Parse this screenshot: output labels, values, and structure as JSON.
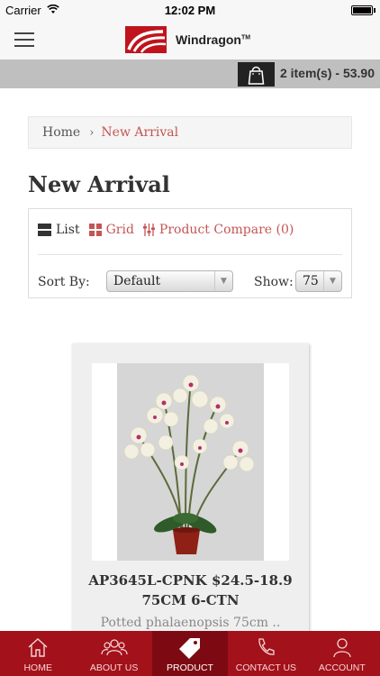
{
  "status_bar": {
    "carrier": "Carrier",
    "time": "12:02 PM"
  },
  "header": {
    "brand": "Windragon",
    "trademark": "TM"
  },
  "cart": {
    "summary": "2 item(s) - 53.90"
  },
  "breadcrumb": {
    "home": "Home",
    "separator": "›",
    "current": "New Arrival"
  },
  "page": {
    "title": "New Arrival"
  },
  "toolbar": {
    "list_label": "List",
    "grid_label": "Grid",
    "compare_label": "Product Compare (0)",
    "sort_label": "Sort By:",
    "sort_value": "Default",
    "show_label": "Show:",
    "show_value": "75"
  },
  "product": {
    "title_line1": "AP3645L-CPNK $24.5-18.9",
    "title_line2": "75CM 6-CTN",
    "description": "Potted phalaenopsis 75cm .."
  },
  "tabs": [
    {
      "label": "HOME",
      "icon": "home-icon"
    },
    {
      "label": "ABOUT US",
      "icon": "people-icon"
    },
    {
      "label": "PRODUCT",
      "icon": "tag-icon",
      "active": true
    },
    {
      "label": "CONTACT US",
      "icon": "phone-icon"
    },
    {
      "label": "ACCOUNT",
      "icon": "user-icon"
    }
  ],
  "colors": {
    "accent": "#c45555",
    "tab_bar": "#a3111b",
    "tab_active": "#7d0a12",
    "cart_bar": "#bfbfbf"
  }
}
